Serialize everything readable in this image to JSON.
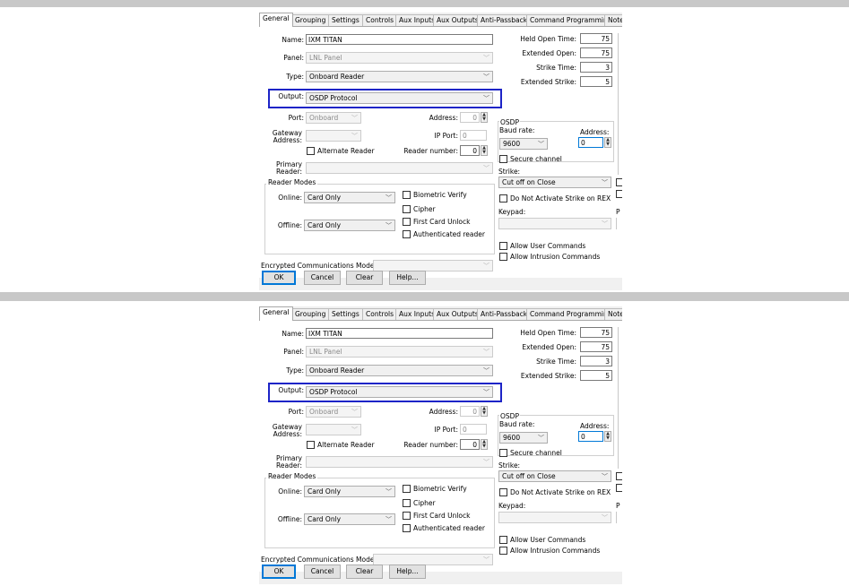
{
  "tabs": [
    "General",
    "Grouping",
    "Settings",
    "Controls",
    "Aux Inputs",
    "Aux Outputs",
    "Anti-Passback",
    "Command Programming",
    "Note"
  ],
  "form": {
    "name_label": "Name:",
    "name_value": "IXM TITAN",
    "panel_label": "Panel:",
    "panel_value": "LNL Panel",
    "type_label": "Type:",
    "type_value": "Onboard Reader",
    "output_label": "Output:",
    "output_value": "OSDP Protocol",
    "port_label": "Port:",
    "port_value": "Onboard",
    "address_label": "Address:",
    "address_value": "0",
    "gateway_label_1": "Gateway",
    "gateway_label_2": "Address:",
    "ip_port_label": "IP Port:",
    "ip_port_value": "0",
    "alternate_reader": "Alternate Reader",
    "reader_number_label": "Reader number:",
    "reader_number_value": "0",
    "primary_label_1": "Primary",
    "primary_label_2": "Reader:",
    "reader_modes_title": "Reader Modes",
    "online_label": "Online:",
    "online_value": "Card Only",
    "offline_label": "Offline:",
    "offline_value": "Card Only",
    "biometric_verify": "Biometric Verify",
    "cipher": "Cipher",
    "first_card_unlock": "First Card Unlock",
    "authenticated_reader": "Authenticated reader",
    "encrypted_label": "Encrypted Communications Mode:"
  },
  "right": {
    "held_open_label": "Held Open Time:",
    "held_open_value": "75",
    "extended_open_label": "Extended Open:",
    "extended_open_value": "75",
    "strike_time_label": "Strike Time:",
    "strike_time_value": "3",
    "extended_strike_label": "Extended Strike:",
    "extended_strike_value": "5",
    "osdp_title": "OSDP",
    "baud_rate_label": "Baud rate:",
    "baud_rate_value": "9600",
    "osdp_address_label": "Address:",
    "osdp_address_value": "0",
    "secure_channel": "Secure channel",
    "strike_label": "Strike:",
    "strike_value": "Cut off on Close",
    "do_not_activate": "Do Not Activate Strike on REX",
    "keypad_label": "Keypad:",
    "allow_user_commands": "Allow User Commands",
    "allow_intrusion_commands": "Allow Intrusion Commands",
    "cut_letter": "P"
  },
  "buttons": {
    "ok": "OK",
    "cancel": "Cancel",
    "clear": "Clear",
    "help": "Help..."
  },
  "colors": {
    "highlight": "#1d24c7",
    "accent": "#0078d7"
  }
}
